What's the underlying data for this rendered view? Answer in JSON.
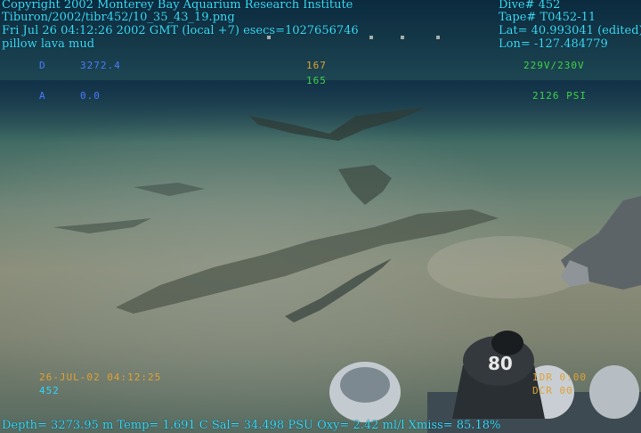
{
  "header": {
    "copyright": "Copyright 2002 Monterey Bay Aquarium Research Institute",
    "file_path": "Tiburon/2002/tibr452/10_35_43_19.png",
    "timestamp": "Fri Jul 26 04:12:26 2002 GMT (local +7)",
    "esecs": "esecs=1027656746",
    "description": "pillow lava mud"
  },
  "dive_info": {
    "dive": "Dive# 452",
    "tape": "Tape# T0452-11",
    "lat": "Lat= 40.993041 (edited)",
    "lon": "Lon= -127.484779"
  },
  "hud": {
    "d_label": "D",
    "d_value": "3272.4",
    "a_label": "A",
    "a_value": "0.0",
    "heading1": "167",
    "heading2": "165",
    "voltage": "229V/230V",
    "pressure": "2126 PSI",
    "date_time": "26-JUL-02 04:12:25",
    "dive_no": "452",
    "tag1": "IDR 0:00",
    "tag2": "DCR 00"
  },
  "footer": {
    "sensors": "Depth= 3273.95 m  Temp= 1.691 C  Sal= 34.498 PSU  Oxy= 2.42 ml/l  Xmiss= 85.18%"
  },
  "sampler_label": "80"
}
